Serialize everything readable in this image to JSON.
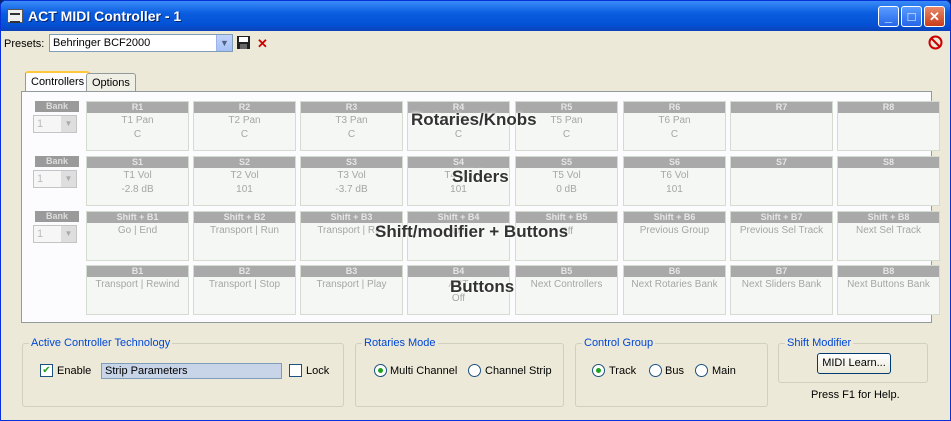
{
  "window": {
    "title": "ACT MIDI Controller - 1",
    "controls": {
      "minimize": "_",
      "maximize": "□",
      "close": "✕"
    }
  },
  "presets": {
    "label": "Presets:",
    "value": "Behringer BCF2000",
    "save_icon": "save-icon",
    "delete_icon": "delete-icon",
    "disable_icon": "no-icon"
  },
  "tabs": [
    {
      "label": "Controllers",
      "active": true
    },
    {
      "label": "Options",
      "active": false
    }
  ],
  "rows": [
    {
      "bank_label": "Bank",
      "bank_value": "1",
      "overlay": "Rotaries/Knobs",
      "cells": [
        {
          "header": "R1",
          "l1": "T1 Pan",
          "l2": "C"
        },
        {
          "header": "R2",
          "l1": "T2 Pan",
          "l2": "C"
        },
        {
          "header": "R3",
          "l1": "T3 Pan",
          "l2": "C"
        },
        {
          "header": "R4",
          "l1": "T4 Pan",
          "l2": "C"
        },
        {
          "header": "R5",
          "l1": "T5 Pan",
          "l2": "C"
        },
        {
          "header": "R6",
          "l1": "T6 Pan",
          "l2": "C"
        },
        {
          "header": "R7",
          "l1": "",
          "l2": ""
        },
        {
          "header": "R8",
          "l1": "",
          "l2": ""
        }
      ]
    },
    {
      "bank_label": "Bank",
      "bank_value": "1",
      "overlay": "Sliders",
      "cells": [
        {
          "header": "S1",
          "l1": "T1 Vol",
          "l2": "-2.8 dB"
        },
        {
          "header": "S2",
          "l1": "T2 Vol",
          "l2": "101"
        },
        {
          "header": "S3",
          "l1": "T3 Vol",
          "l2": "-3.7 dB"
        },
        {
          "header": "S4",
          "l1": "T4 Vol",
          "l2": "101"
        },
        {
          "header": "S5",
          "l1": "T5 Vol",
          "l2": "0 dB"
        },
        {
          "header": "S6",
          "l1": "T6 Vol",
          "l2": "101"
        },
        {
          "header": "S7",
          "l1": "",
          "l2": ""
        },
        {
          "header": "S8",
          "l1": "",
          "l2": ""
        }
      ]
    },
    {
      "bank_label": "Bank",
      "bank_value": "1",
      "overlay": "Shift/modifier + Buttons",
      "cells": [
        {
          "header": "Shift + B1",
          "l1": "Go | End",
          "l2": ""
        },
        {
          "header": "Shift + B2",
          "l1": "Transport | Run",
          "l2": ""
        },
        {
          "header": "Shift + B3",
          "l1": "Transport | Rec",
          "l2": ""
        },
        {
          "header": "Shift + B4",
          "l1": "",
          "l2": "Off"
        },
        {
          "header": "Shift + B5",
          "l1": "",
          "l2": "Off"
        },
        {
          "header": "Shift + B6",
          "l1": "Previous Group",
          "l2": ""
        },
        {
          "header": "Shift + B7",
          "l1": "Previous Sel Track",
          "l2": ""
        },
        {
          "header": "Shift + B8",
          "l1": "Next Sel Track",
          "l2": ""
        }
      ]
    },
    {
      "bank_label": "",
      "bank_value": "",
      "overlay": "Buttons",
      "cells": [
        {
          "header": "B1",
          "l1": "Transport | Rewind",
          "l2": ""
        },
        {
          "header": "B2",
          "l1": "Transport | Stop",
          "l2": ""
        },
        {
          "header": "B3",
          "l1": "Transport | Play",
          "l2": ""
        },
        {
          "header": "B4",
          "l1": "ACT",
          "l2": "Off"
        },
        {
          "header": "B5",
          "l1": "Next Controllers",
          "l2": ""
        },
        {
          "header": "B6",
          "l1": "Next Rotaries Bank",
          "l2": ""
        },
        {
          "header": "B7",
          "l1": "Next Sliders Bank",
          "l2": ""
        },
        {
          "header": "B8",
          "l1": "Next Buttons Bank",
          "l2": ""
        }
      ]
    }
  ],
  "act": {
    "title": "Active Controller Technology",
    "enable_label": "Enable",
    "enable_checked": true,
    "text": "Strip Parameters",
    "lock_label": "Lock",
    "lock_checked": false
  },
  "rotaries_mode": {
    "title": "Rotaries Mode",
    "options": [
      "Multi Channel",
      "Channel Strip"
    ],
    "selected": 0
  },
  "control_group": {
    "title": "Control Group",
    "options": [
      "Track",
      "Bus",
      "Main"
    ],
    "selected": 0
  },
  "shift_modifier": {
    "title": "Shift Modifier",
    "button": "MIDI Learn..."
  },
  "help": "Press F1 for Help."
}
